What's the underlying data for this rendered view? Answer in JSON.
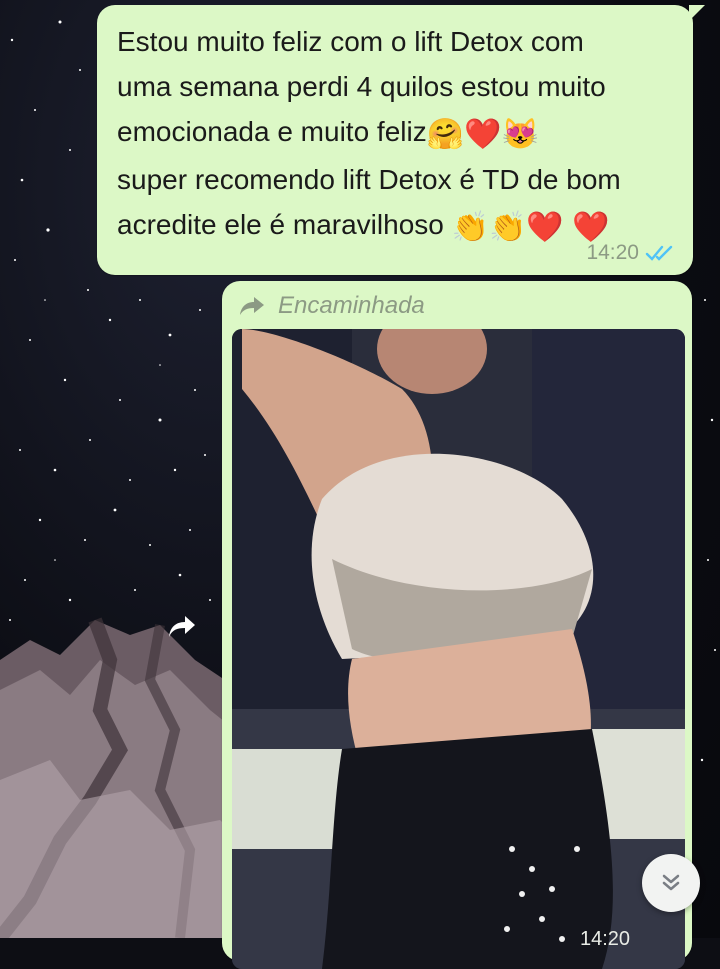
{
  "conversation": {
    "message_1": {
      "lines": [
        "Estou muito feliz com o lift Detox com",
        "uma semana perdi 4 quilos estou muito",
        "emocionada e muito feliz",
        "super recomendo lift Detox é TD de bom",
        "acredite ele é maravilhoso"
      ],
      "line3_emojis": "🤗❤️😻",
      "line5_emojis": "👏👏❤️ ❤️",
      "time": "14:20",
      "status_icon": "double-check-read-icon"
    },
    "message_2": {
      "forwarded_label": "Encaminhada",
      "forwarded_icon": "forward-arrow-icon",
      "attachment": "photo",
      "time": "14:20"
    }
  },
  "controls": {
    "share_icon": "share-forward-icon",
    "scroll_down_icon": "double-chevron-down-icon"
  },
  "colors": {
    "bubble": "#dcf8c6",
    "meta_text": "#8c9a84",
    "read_check": "#4fc3f7"
  }
}
